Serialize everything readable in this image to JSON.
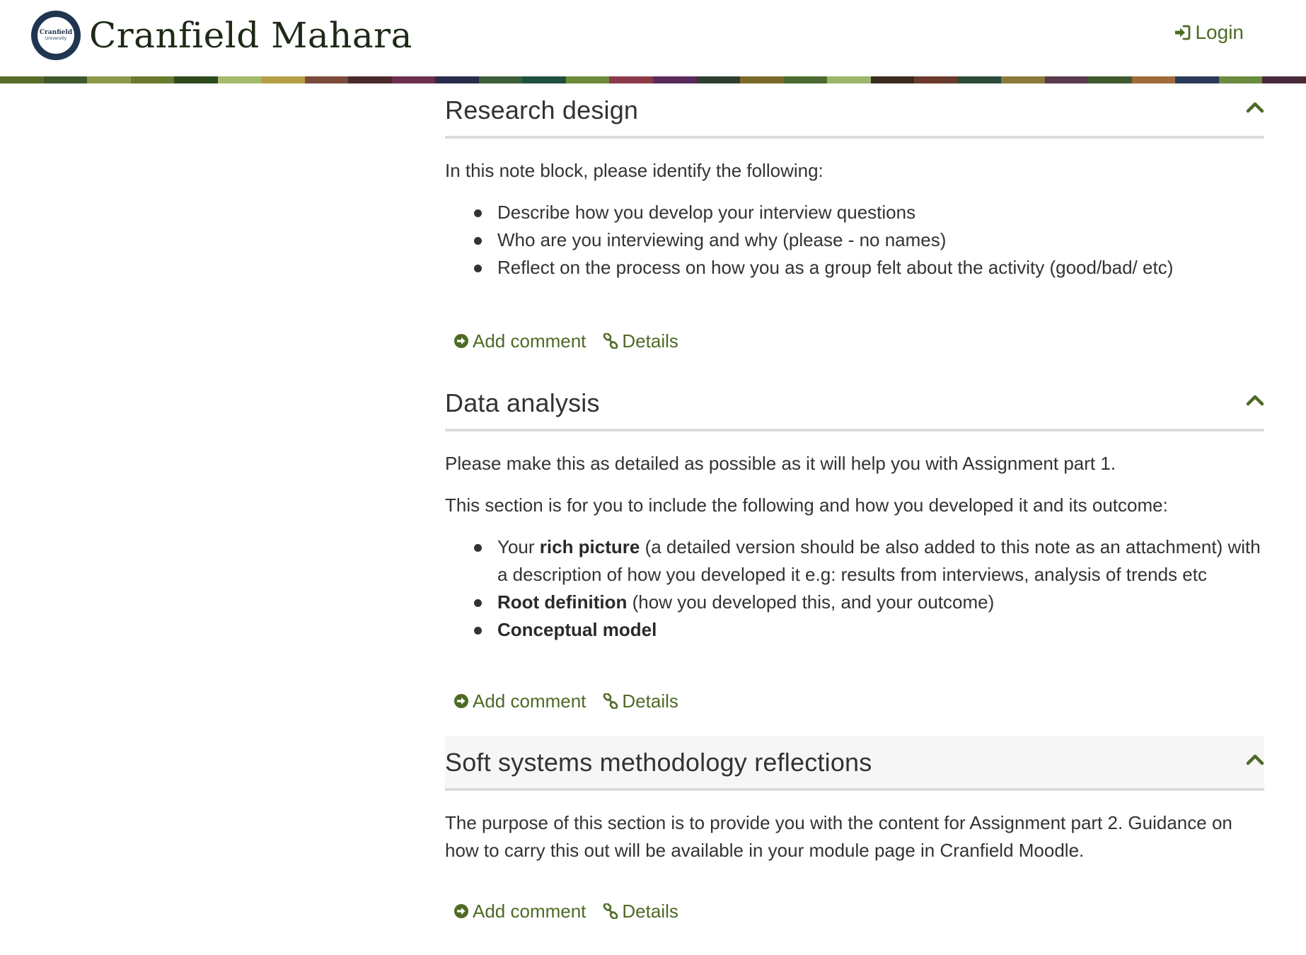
{
  "header": {
    "logo_line1": "Cranfield",
    "logo_line2": "University",
    "site_title": "Cranfield Mahara",
    "login_label": "Login"
  },
  "pattern_colors": [
    "#5b6b2a",
    "#3e5a2a",
    "#8b9a4a",
    "#6a7a2f",
    "#2f4a1f",
    "#a7b96a",
    "#b6a045",
    "#7a4a3a",
    "#4b2a2a",
    "#6b2f4a",
    "#2a2a4a",
    "#3b5f3b",
    "#1f4f3f",
    "#6f8b3a",
    "#8b3a4a",
    "#5a2a5a",
    "#2f3f2f",
    "#7a6a2a",
    "#4a6b2f",
    "#9bb56a",
    "#3a2a1f",
    "#6a3a2a",
    "#2a4a3a",
    "#8a7a3a",
    "#5a3a4a",
    "#3f5a2f",
    "#a06a3a",
    "#2a3a5a",
    "#6b8b3f",
    "#4a2a3a"
  ],
  "blocks": [
    {
      "title": "Research design",
      "paragraphs": [
        "In this note block, please identify the following:"
      ],
      "bullets": [
        "Describe how you develop your interview questions",
        "Who are you interviewing and why (please - no names)",
        "Reflect on the process on how you as a group felt about the activity (good/bad/ etc)"
      ],
      "add_comment": "Add comment",
      "details": "Details"
    },
    {
      "title": "Data analysis",
      "paragraphs": [
        "Please make this as detailed as possible as it will help you with Assignment part 1.",
        "This section is for you to include the following and how you developed it and its outcome:"
      ],
      "bullet1": {
        "pre": "Your ",
        "bold": "rich picture",
        "post": " (a detailed version should be also added to this note as an attachment) with a description of how you developed it e.g: results from interviews, analysis of trends etc"
      },
      "bullet2": {
        "bold": "Root definition",
        "post": " (how you developed this, and your outcome)"
      },
      "bullet3": {
        "bold": "Conceptual model"
      },
      "add_comment": "Add comment",
      "details": "Details"
    },
    {
      "title": "Soft systems methodology reflections",
      "paragraphs": [
        "The purpose of this section is to provide you with the content for Assignment part 2. Guidance on how to carry this out will be available in your module page in Cranfield Moodle."
      ],
      "add_comment": "Add comment",
      "details": "Details"
    }
  ],
  "icons": {
    "login": "sign-in-icon",
    "collapse": "chevron-up-icon",
    "add_comment": "arrow-circle-right-icon",
    "details": "link-icon"
  },
  "colors": {
    "accent": "#4e6a25",
    "text": "#333333",
    "divider": "#dcdcdc",
    "logo_navy": "#1f3550"
  }
}
